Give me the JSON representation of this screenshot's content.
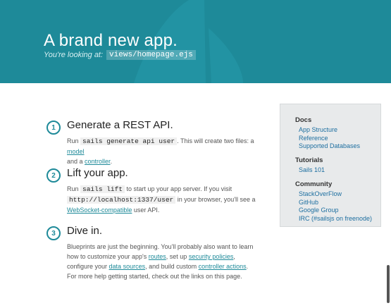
{
  "hero": {
    "title": "A brand new app.",
    "subtitle_prefix": "You're looking at:",
    "subtitle_code": "views/homepage.ejs"
  },
  "steps": [
    {
      "number": "1",
      "title": "Generate a REST API.",
      "parts": [
        "Run ",
        "sails generate api user",
        ". This will create two files: a ",
        "model",
        " and a ",
        "controller",
        "."
      ]
    },
    {
      "number": "2",
      "title": "Lift your app.",
      "parts": [
        "Run ",
        "sails lift",
        " to start up your app server. If you visit ",
        "http://localhost:1337/user",
        " in your browser, you'll see a ",
        "WebSocket-compatible",
        " user API."
      ]
    },
    {
      "number": "3",
      "title": "Dive in.",
      "parts": [
        "Blueprints are just the beginning. You'll probably also want to learn how to customize your app's ",
        "routes",
        ", set up ",
        "security policies",
        ", configure your ",
        "data sources",
        ", and build custom ",
        "controller actions",
        ". For more help getting started, check out the links on this page."
      ]
    }
  ],
  "sidebar": {
    "docs_heading": "Docs",
    "docs": [
      "App Structure",
      "Reference",
      "Supported Databases"
    ],
    "tutorials_heading": "Tutorials",
    "tutorials": [
      "Sails 101"
    ],
    "community_heading": "Community",
    "community": [
      "StackOverFlow",
      "GitHub",
      "Google Group",
      "IRC (#sailsjs on freenode)"
    ]
  },
  "colors": {
    "hero_bg": "#1e8a99",
    "accent": "#1e8a99",
    "link": "#1e6fa0",
    "sidebar_bg": "#e8eaeb"
  }
}
